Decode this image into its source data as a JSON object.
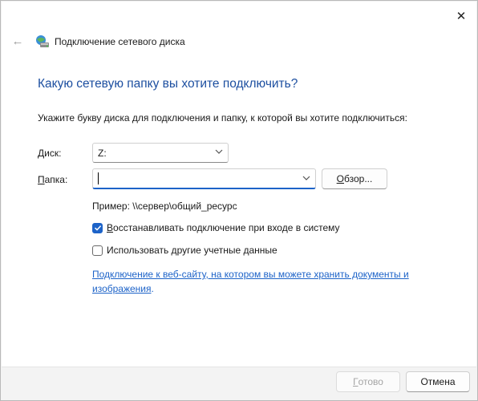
{
  "window": {
    "title": "Подключение сетевого диска",
    "close_glyph": "✕",
    "back_glyph": "←"
  },
  "main": {
    "heading": "Какую сетевую папку вы хотите подключить?",
    "instruction": "Укажите букву диска для подключения и папку, к которой вы хотите подключиться:"
  },
  "drive": {
    "label_prefix": "",
    "label_hot": "Д",
    "label_rest": "иск:",
    "value": "Z:"
  },
  "folder": {
    "label_hot": "П",
    "label_rest": "апка:",
    "value": "",
    "browse_hot": "О",
    "browse_rest": "бзор..."
  },
  "example": "Пример: \\\\сервер\\общий_ресурс",
  "options": {
    "reconnect": {
      "checked": true,
      "label_hot": "В",
      "label_rest": "осстанавливать подключение при входе в систему"
    },
    "other_credentials": {
      "checked": false,
      "label_pre": "Использовать другие учетные ",
      "label_hot": "д",
      "label_rest": "анные"
    }
  },
  "link": {
    "text": "Подключение к веб-сайту, на котором вы можете хранить документы и изображения",
    "trailing": "."
  },
  "footer": {
    "ok_hot": "Г",
    "ok_rest": "отово",
    "cancel_label": "Отмена"
  },
  "colors": {
    "accent": "#1d63c8",
    "heading": "#1d4fa0",
    "disabled_text": "#a4a4a4"
  }
}
